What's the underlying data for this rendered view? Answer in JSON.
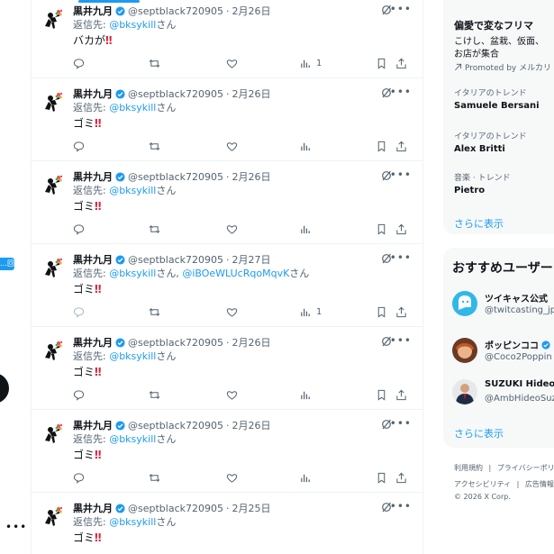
{
  "left_rail": {
    "badge": "…回",
    "more": "•••"
  },
  "tweets": [
    {
      "name": "黒井九月",
      "handle": "@septblack720905",
      "date": "2月26日",
      "reply_prefix": "返信先: ",
      "mentions": [
        "@bksykill"
      ],
      "reply_suffix": "さん",
      "text": "バカが",
      "bang": "‼",
      "views": "1"
    },
    {
      "name": "黒井九月",
      "handle": "@septblack720905",
      "date": "2月26日",
      "reply_prefix": "返信先: ",
      "mentions": [
        "@bksykill"
      ],
      "reply_suffix": "さん",
      "text": "ゴミ",
      "bang": "‼",
      "views": ""
    },
    {
      "name": "黒井九月",
      "handle": "@septblack720905",
      "date": "2月26日",
      "reply_prefix": "返信先: ",
      "mentions": [
        "@bksykill"
      ],
      "reply_suffix": "さん",
      "text": "ゴミ",
      "bang": "‼",
      "views": ""
    },
    {
      "name": "黒井九月",
      "handle": "@septblack720905",
      "date": "2月27日",
      "reply_prefix": "返信先: ",
      "mentions": [
        "@bksykill",
        "@iBOeWLUcRqoMqvK"
      ],
      "reply_suffix": "さん",
      "text": "ゴミ",
      "bang": "‼",
      "views": "1"
    },
    {
      "name": "黒井九月",
      "handle": "@septblack720905",
      "date": "2月26日",
      "reply_prefix": "返信先: ",
      "mentions": [
        "@bksykill"
      ],
      "reply_suffix": "さん",
      "text": "ゴミ",
      "bang": "‼",
      "views": ""
    },
    {
      "name": "黒井九月",
      "handle": "@septblack720905",
      "date": "2月26日",
      "reply_prefix": "返信先: ",
      "mentions": [
        "@bksykill"
      ],
      "reply_suffix": "さん",
      "text": "ゴミ",
      "bang": "‼",
      "views": ""
    },
    {
      "name": "黒井九月",
      "handle": "@septblack720905",
      "date": "2月25日",
      "reply_prefix": "返信先: ",
      "mentions": [
        "@bksykill"
      ],
      "reply_suffix": "さん",
      "text": "ゴミ",
      "bang": "‼",
      "views": ""
    }
  ],
  "trends": {
    "promo": {
      "title": "偏愛で変なフリマ",
      "desc_1": "こけし、盆栽、仮面、",
      "desc_2": "お店が集合",
      "by": "Promoted by メルカリ"
    },
    "items": [
      {
        "context": "イタリアのトレンド",
        "name": "Samuele Bersani"
      },
      {
        "context": "イタリアのトレンド",
        "name": "Alex Britti"
      },
      {
        "context": "音楽 · トレンド",
        "name": "Pietro"
      }
    ],
    "show_more": "さらに表示"
  },
  "who_to_follow": {
    "title": "おすすめユーザー",
    "users": [
      {
        "name": "ツイキャス公式",
        "handle": "@twitcasting_jp"
      },
      {
        "name": "ポッピンココ",
        "handle": "@Coco2Poppin"
      },
      {
        "name": "SUZUKI Hideo",
        "handle": "@AmbHideoSuz"
      }
    ],
    "show_more": "さらに表示"
  },
  "footer": {
    "line1_a": "利用規約",
    "sep": "|",
    "line1_b": "プライバシーポリ",
    "line2_a": "アクセシビリティ",
    "line2_b": "広告情報",
    "copyright": "© 2026 X Corp."
  },
  "colors": {
    "accent": "#1d9bf0",
    "text": "#0f1419",
    "muted": "#536471",
    "bang": "#d8263f"
  }
}
